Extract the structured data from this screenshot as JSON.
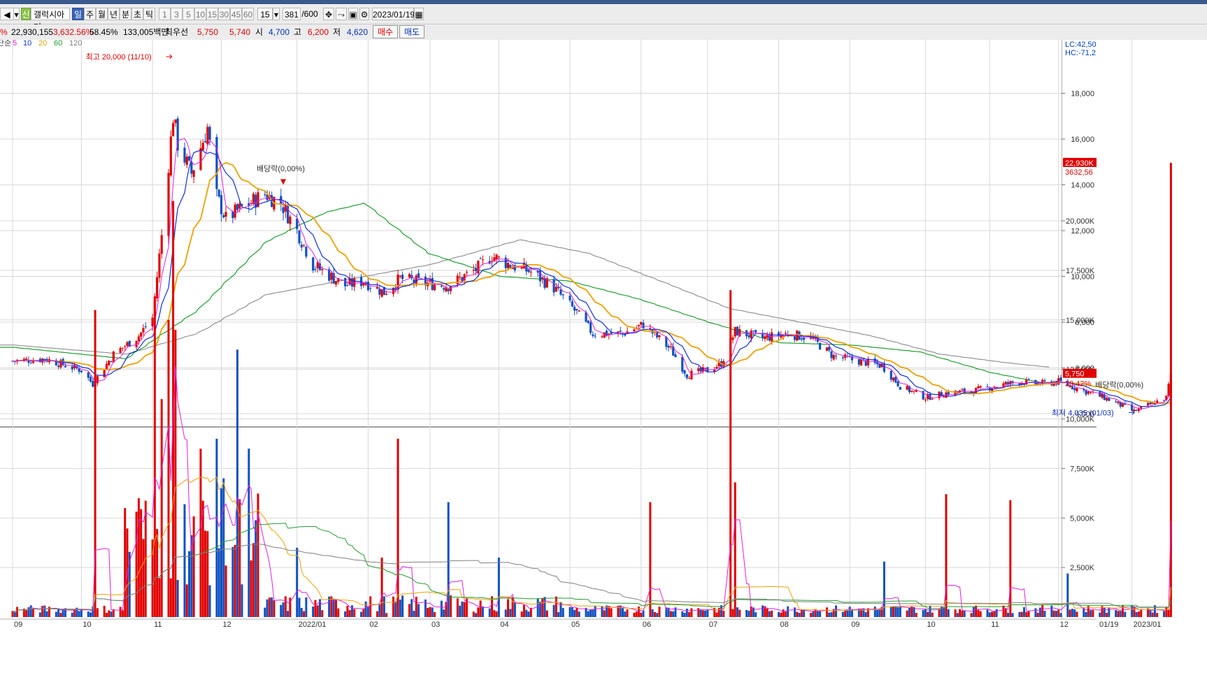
{
  "toolbar": {
    "badge": "신",
    "stock_name": "갤럭시아머",
    "periods": [
      "일",
      "주",
      "월",
      "년",
      "분",
      "초",
      "틱"
    ],
    "active_period": "일",
    "intervals": [
      "1",
      "3",
      "5",
      "10",
      "15",
      "30",
      "45",
      "60"
    ],
    "interval_select": "15",
    "count": "381",
    "count_total": "/600",
    "date": "2023/01/19"
  },
  "quote": {
    "prefix": "%",
    "volume": "22,930,155",
    "vol_rate": "3,632.56%",
    "turnover": "58.45%",
    "amount": "133,005백만",
    "best_label": "최우선",
    "ask": "5,750",
    "bid": "5,740",
    "open_label": "시",
    "open": "4,700",
    "high_label": "고",
    "high": "6,200",
    "low_label": "저",
    "low": "4,620",
    "buy_label": "매수",
    "sell_label": "매도"
  },
  "legend": {
    "prefix": "단순",
    "items": [
      {
        "label": "5",
        "color": "#e020e0"
      },
      {
        "label": "10",
        "color": "#1030e0"
      },
      {
        "label": "20",
        "color": "#f0a000"
      },
      {
        "label": "60",
        "color": "#20a030"
      },
      {
        "label": "120",
        "color": "#808080"
      }
    ]
  },
  "right_header": {
    "lc": "LC:42,50",
    "hc": "HC:-71,2"
  },
  "colors": {
    "up": "#e00000",
    "down": "#1050c0",
    "ma5": "#e020e0",
    "ma10": "#1030e0",
    "ma20": "#f0a000",
    "ma60": "#20a030",
    "ma120": "#808080",
    "grid": "#d8d8d8"
  },
  "chart_data": [
    {
      "type": "candlestick",
      "title": "",
      "y_ticks": [
        "4,000",
        "6,000",
        "8,000",
        "10,000",
        "12,000",
        "14,000",
        "16,000",
        "18,000"
      ],
      "ylim": [
        3500,
        21000
      ],
      "x_ticks": [
        "09",
        "10",
        "11",
        "12",
        "2022/01",
        "02",
        "03",
        "04",
        "05",
        "06",
        "07",
        "08",
        "09",
        "10",
        "11",
        "12",
        "2023/01"
      ],
      "x_end_label": "01/19",
      "last_price": "5,750",
      "last_change": "20,42%",
      "annotations": {
        "high": "최고 20,000 (11/10)",
        "low": "최저 4,035 (01/03)",
        "dividend1": "배당락(0,00%)",
        "dividend2": "배당락(0,00%)"
      },
      "price_path": [
        [
          "2021-09-01",
          6300
        ],
        [
          "2021-09-15",
          6400
        ],
        [
          "2021-10-01",
          5900
        ],
        [
          "2021-10-06",
          5300
        ],
        [
          "2021-10-15",
          6600
        ],
        [
          "2021-10-26",
          7400
        ],
        [
          "2021-11-01",
          8200
        ],
        [
          "2021-11-05",
          11800
        ],
        [
          "2021-11-10",
          17000
        ],
        [
          "2021-11-12",
          15800
        ],
        [
          "2021-11-18",
          14500
        ],
        [
          "2021-11-25",
          16500
        ],
        [
          "2021-11-29",
          13500
        ],
        [
          "2021-12-03",
          12500
        ],
        [
          "2021-12-10",
          13000
        ],
        [
          "2021-12-20",
          13600
        ],
        [
          "2021-12-27",
          13200
        ],
        [
          "2022-01-03",
          12000
        ],
        [
          "2022-01-10",
          10500
        ],
        [
          "2022-01-24",
          9600
        ],
        [
          "2022-02-01",
          9800
        ],
        [
          "2022-02-10",
          9300
        ],
        [
          "2022-02-17",
          9900
        ],
        [
          "2022-02-28",
          9700
        ],
        [
          "2022-03-10",
          9600
        ],
        [
          "2022-03-22",
          10300
        ],
        [
          "2022-03-29",
          10900
        ],
        [
          "2022-04-06",
          10500
        ],
        [
          "2022-04-15",
          10200
        ],
        [
          "2022-04-25",
          9500
        ],
        [
          "2022-05-05",
          8400
        ],
        [
          "2022-05-12",
          7500
        ],
        [
          "2022-05-25",
          7500
        ],
        [
          "2022-06-03",
          7900
        ],
        [
          "2022-06-15",
          6800
        ],
        [
          "2022-06-22",
          5700
        ],
        [
          "2022-07-01",
          5900
        ],
        [
          "2022-07-07",
          6200
        ],
        [
          "2022-07-13",
          7600
        ],
        [
          "2022-07-25",
          7300
        ],
        [
          "2022-08-05",
          7500
        ],
        [
          "2022-08-15",
          7300
        ],
        [
          "2022-08-25",
          6500
        ],
        [
          "2022-09-05",
          6300
        ],
        [
          "2022-09-15",
          6100
        ],
        [
          "2022-09-23",
          5200
        ],
        [
          "2022-10-04",
          4700
        ],
        [
          "2022-10-13",
          4900
        ],
        [
          "2022-10-25",
          5000
        ],
        [
          "2022-11-03",
          5200
        ],
        [
          "2022-11-14",
          5400
        ],
        [
          "2022-11-22",
          5300
        ],
        [
          "2022-12-01",
          5400
        ],
        [
          "2022-12-12",
          5000
        ],
        [
          "2022-12-21",
          4700
        ],
        [
          "2023-01-03",
          4100
        ],
        [
          "2023-01-10",
          4400
        ],
        [
          "2023-01-17",
          4700
        ],
        [
          "2023-01-19",
          5750
        ]
      ],
      "ma": {
        "ma20": [
          [
            "2021-09-01",
            6500
          ],
          [
            "2021-10-10",
            5800
          ],
          [
            "2021-11-01",
            6800
          ],
          [
            "2021-11-15",
            11000
          ],
          [
            "2021-12-01",
            15500
          ],
          [
            "2021-12-20",
            13800
          ],
          [
            "2022-01-10",
            12600
          ],
          [
            "2022-02-01",
            10300
          ],
          [
            "2022-03-01",
            9700
          ],
          [
            "2022-04-01",
            10100
          ],
          [
            "2022-04-25",
            10100
          ],
          [
            "2022-05-20",
            8300
          ],
          [
            "2022-06-15",
            7200
          ],
          [
            "2022-07-05",
            6000
          ],
          [
            "2022-08-05",
            7200
          ],
          [
            "2022-08-25",
            7300
          ],
          [
            "2022-09-25",
            6000
          ],
          [
            "2022-10-20",
            5000
          ],
          [
            "2022-11-20",
            5200
          ],
          [
            "2022-12-15",
            5200
          ],
          [
            "2023-01-10",
            4500
          ],
          [
            "2023-01-19",
            4500
          ]
        ],
        "ma60": [
          [
            "2021-09-01",
            6900
          ],
          [
            "2021-10-20",
            6400
          ],
          [
            "2021-11-20",
            8500
          ],
          [
            "2021-12-20",
            11500
          ],
          [
            "2022-01-15",
            12800
          ],
          [
            "2022-02-01",
            13200
          ],
          [
            "2022-03-01",
            11000
          ],
          [
            "2022-04-01",
            10000
          ],
          [
            "2022-05-01",
            9800
          ],
          [
            "2022-06-01",
            9000
          ],
          [
            "2022-07-01",
            8000
          ],
          [
            "2022-08-01",
            7100
          ],
          [
            "2022-09-01",
            7000
          ],
          [
            "2022-10-01",
            6700
          ],
          [
            "2022-11-01",
            5800
          ],
          [
            "2022-12-01",
            5200
          ],
          [
            "2023-01-19",
            4900
          ]
        ],
        "ma120": [
          [
            "2021-09-01",
            7000
          ],
          [
            "2021-10-20",
            6600
          ],
          [
            "2021-11-20",
            7500
          ],
          [
            "2021-12-20",
            9200
          ],
          [
            "2022-02-01",
            10000
          ],
          [
            "2022-03-01",
            10500
          ],
          [
            "2022-04-10",
            11600
          ],
          [
            "2022-05-10",
            11000
          ],
          [
            "2022-06-10",
            9800
          ],
          [
            "2022-07-10",
            8600
          ],
          [
            "2022-08-10",
            8000
          ],
          [
            "2022-09-10",
            7400
          ],
          [
            "2022-10-10",
            6600
          ],
          [
            "2022-11-10",
            6200
          ],
          [
            "2022-12-10",
            5900
          ],
          [
            "2023-01-19",
            5600
          ]
        ]
      }
    },
    {
      "type": "bar",
      "title": "",
      "y_ticks": [
        "2,500K",
        "5,000K",
        "7,500K",
        "10,000K",
        "12,500K",
        "15,000K",
        "17,500K",
        "20,000K"
      ],
      "ylim": [
        0,
        23500
      ],
      "last_volume": "22,930K",
      "last_ratio": "3632,56",
      "spikes_k": [
        [
          "2021-10-07",
          15500
        ],
        [
          "2021-10-20",
          5500
        ],
        [
          "2021-10-26",
          6000
        ],
        [
          "2021-11-02",
          16000
        ],
        [
          "2021-11-05",
          11000
        ],
        [
          "2021-11-08",
          15000
        ],
        [
          "2021-11-10",
          21000
        ],
        [
          "2021-11-11",
          14500
        ],
        [
          "2021-11-22",
          8500
        ],
        [
          "2021-11-29",
          9000
        ],
        [
          "2021-12-02",
          7000
        ],
        [
          "2021-12-08",
          13500
        ],
        [
          "2021-12-13",
          8500
        ],
        [
          "2022-01-03",
          3500
        ],
        [
          "2022-02-09",
          3000
        ],
        [
          "2022-02-16",
          9000
        ],
        [
          "2022-03-10",
          5800
        ],
        [
          "2022-04-01",
          3000
        ],
        [
          "2022-06-06",
          5800
        ],
        [
          "2022-07-11",
          16500
        ],
        [
          "2022-07-13",
          6800
        ],
        [
          "2022-09-16",
          2800
        ],
        [
          "2022-10-13",
          6200
        ],
        [
          "2022-11-10",
          5900
        ],
        [
          "2022-12-05",
          2200
        ],
        [
          "2023-01-19",
          22930
        ]
      ]
    }
  ]
}
